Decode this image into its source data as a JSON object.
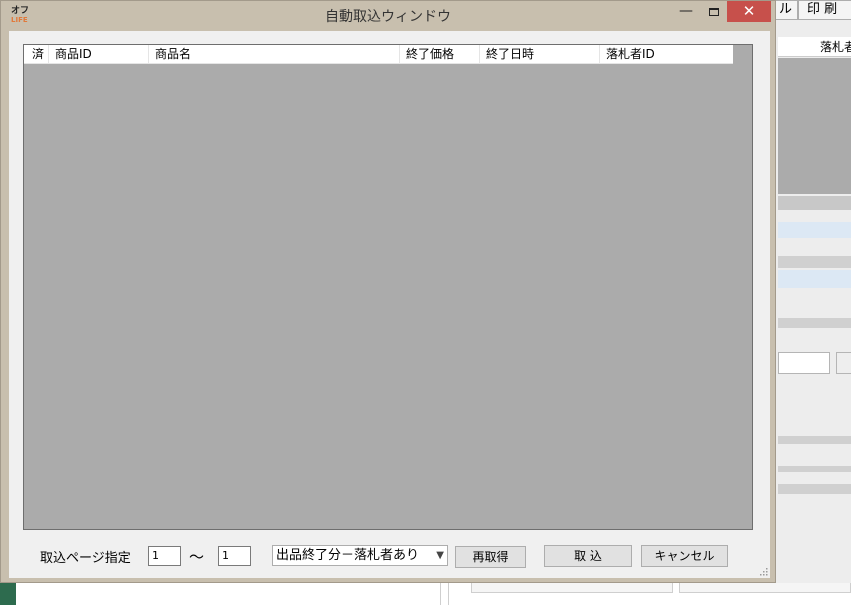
{
  "dialog": {
    "title": "自動取込ウィンドウ",
    "app_icon": {
      "line1": "オフ",
      "line2": "LIFE"
    },
    "controls": {
      "minimize": "—",
      "maximize": "",
      "close": "✕"
    }
  },
  "list": {
    "columns": [
      "済",
      "商品ID",
      "商品名",
      "終了価格",
      "終了日時",
      "落札者ID"
    ],
    "rows": []
  },
  "footer": {
    "page_label": "取込ページ指定",
    "page_from": "1",
    "tilde": "〜",
    "page_to": "1",
    "filter_selected": "出品終了分－落札者あり",
    "refetch_button": "再取得",
    "import_button": "取 込",
    "cancel_button": "キャンセル"
  },
  "background_app": {
    "top_buttons": [
      "ル",
      "印 刷"
    ],
    "header_cell": "落札者"
  },
  "colors": {
    "title_bar": "#c8bfae",
    "list_background": "#ababab",
    "close_button": "#c7504b"
  }
}
